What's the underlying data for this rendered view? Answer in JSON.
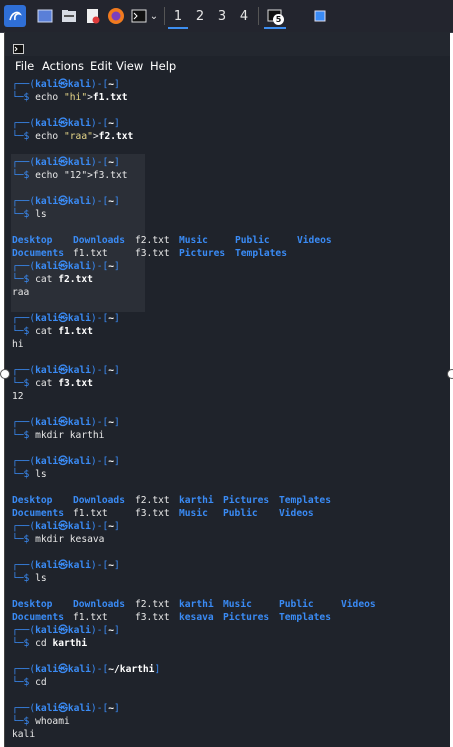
{
  "taskbar": {
    "workspaces": [
      "1",
      "2",
      "3",
      "4"
    ],
    "badge": "5"
  },
  "menu": [
    "File",
    "Actions",
    "Edit",
    "View",
    "Help"
  ],
  "prompt": {
    "top": "┌──(",
    "user": "kali",
    "at": "㉿",
    "host": "kali",
    "mid": ")-[",
    "close": "]",
    "bottom": "└─$ "
  },
  "blocks": [
    {
      "path": "~",
      "cmd": "echo ",
      "str": "\"hi\"",
      "redir": ">",
      "file": "f1.txt"
    },
    {
      "path": "~",
      "cmd": "echo ",
      "str": "\"raa\"",
      "redir": ">",
      "file": "f2.txt"
    },
    {
      "path": "~",
      "cmd": "echo \"12\">f3.txt"
    },
    {
      "path": "~",
      "cmd": "ls"
    },
    {
      "path": "~",
      "cmd": "cat ",
      "file": "f2.txt"
    },
    {
      "path": "~",
      "cmd": "cat ",
      "file": "f1.txt"
    },
    {
      "path": "~",
      "cmd": "cat ",
      "file": "f3.txt"
    },
    {
      "path": "~",
      "cmd": "mkdir karthi"
    },
    {
      "path": "~",
      "cmd": "ls"
    },
    {
      "path": "~",
      "cmd": "mkdir kesava"
    },
    {
      "path": "~",
      "cmd": "ls"
    },
    {
      "path": "~",
      "cmd": "cd ",
      "file": "karthi"
    },
    {
      "path": "~/karthi",
      "cmd": "cd"
    },
    {
      "path": "~",
      "cmd": "whoami"
    }
  ],
  "outputs": {
    "ls1": [
      [
        "Desktop",
        "Downloads",
        "f2.txt",
        "Music",
        "Public",
        "Videos"
      ],
      [
        "Documents",
        "f1.txt",
        "f3.txt",
        "Pictures",
        "Templates"
      ]
    ],
    "cat_f2": "raa",
    "cat_f1": "hi",
    "cat_f3": "12",
    "ls2": [
      [
        "Desktop",
        "Downloads",
        "f2.txt",
        "karthi",
        "Pictures",
        "Templates"
      ],
      [
        "Documents",
        "f1.txt",
        "f3.txt",
        "Music",
        "Public",
        "Videos"
      ]
    ],
    "ls3": [
      [
        "Desktop",
        "Downloads",
        "f2.txt",
        "karthi",
        "Music",
        "Public",
        "Videos"
      ],
      [
        "Documents",
        "f1.txt",
        "f3.txt",
        "kesava",
        "Pictures",
        "Templates"
      ]
    ],
    "whoami": "kali"
  },
  "colors": {
    "accent": "#3a8bf5",
    "terminal_bg": "#1f232b",
    "taskbar_bg": "#23252e"
  }
}
